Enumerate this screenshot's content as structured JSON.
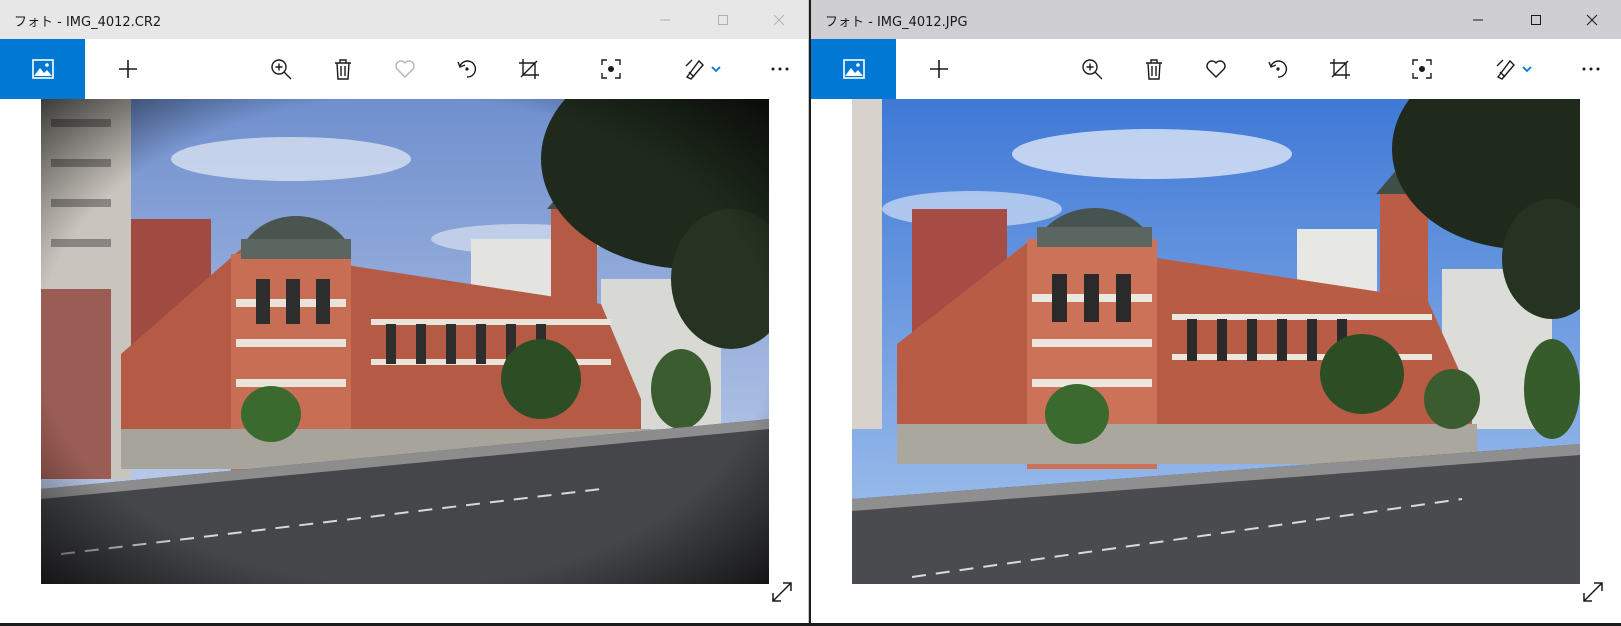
{
  "windows": [
    {
      "title": "フォト - IMG_4012.CR2",
      "active": false,
      "controls": [
        "minimize-icon",
        "maximize-icon",
        "close-icon"
      ],
      "toolbar": [
        "photos-home-icon",
        "add-icon",
        "zoom-in-icon",
        "delete-icon",
        "favorite-icon",
        "rotate-icon",
        "crop-icon",
        "enhance-icon",
        "edit-draw-icon",
        "chevron-down-icon",
        "more-icon"
      ],
      "favorite_enabled": false
    },
    {
      "title": "フォト - IMG_4012.JPG",
      "active": true,
      "controls": [
        "minimize-icon",
        "maximize-icon",
        "close-icon"
      ],
      "toolbar": [
        "photos-home-icon",
        "add-icon",
        "zoom-in-icon",
        "delete-icon",
        "favorite-icon",
        "rotate-icon",
        "crop-icon",
        "enhance-icon",
        "edit-draw-icon",
        "chevron-down-icon",
        "more-icon"
      ],
      "favorite_enabled": true
    }
  ],
  "colors": {
    "accent": "#0078d4",
    "titlebar_inactive": "#e7e7e7",
    "titlebar_active": "#cfcfd3",
    "icon": "#1a1a1a",
    "icon_disabled": "#b5b5b5"
  }
}
